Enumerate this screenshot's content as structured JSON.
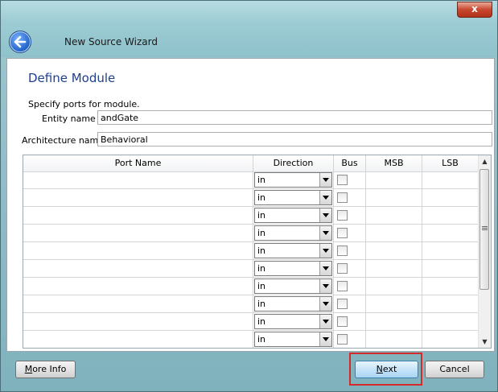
{
  "window": {
    "title": "New Source Wizard",
    "close_glyph": "x"
  },
  "page": {
    "title": "Define Module",
    "hint": "Specify ports for module."
  },
  "fields": {
    "entity_label": "Entity name",
    "entity_value": "andGate",
    "arch_label": "Architecture name",
    "arch_value": "Behavioral"
  },
  "grid": {
    "columns": [
      "Port Name",
      "Direction",
      "Bus",
      "MSB",
      "LSB"
    ],
    "rows": [
      {
        "port_name": "",
        "direction": "in",
        "bus": false,
        "msb": "",
        "lsb": ""
      },
      {
        "port_name": "",
        "direction": "in",
        "bus": false,
        "msb": "",
        "lsb": ""
      },
      {
        "port_name": "",
        "direction": "in",
        "bus": false,
        "msb": "",
        "lsb": ""
      },
      {
        "port_name": "",
        "direction": "in",
        "bus": false,
        "msb": "",
        "lsb": ""
      },
      {
        "port_name": "",
        "direction": "in",
        "bus": false,
        "msb": "",
        "lsb": ""
      },
      {
        "port_name": "",
        "direction": "in",
        "bus": false,
        "msb": "",
        "lsb": ""
      },
      {
        "port_name": "",
        "direction": "in",
        "bus": false,
        "msb": "",
        "lsb": ""
      },
      {
        "port_name": "",
        "direction": "in",
        "bus": false,
        "msb": "",
        "lsb": ""
      },
      {
        "port_name": "",
        "direction": "in",
        "bus": false,
        "msb": "",
        "lsb": ""
      },
      {
        "port_name": "",
        "direction": "in",
        "bus": false,
        "msb": "",
        "lsb": ""
      }
    ]
  },
  "buttons": {
    "more_info": "More Info",
    "next": "Next",
    "cancel": "Cancel"
  },
  "icons": {
    "back": "back-arrow-icon",
    "dropdown": "chevron-down-icon",
    "scroll_up": "scroll-up-icon",
    "scroll_down": "scroll-down-icon"
  },
  "colors": {
    "highlight": "#d42a2a",
    "page_title": "#1f3f8f"
  }
}
